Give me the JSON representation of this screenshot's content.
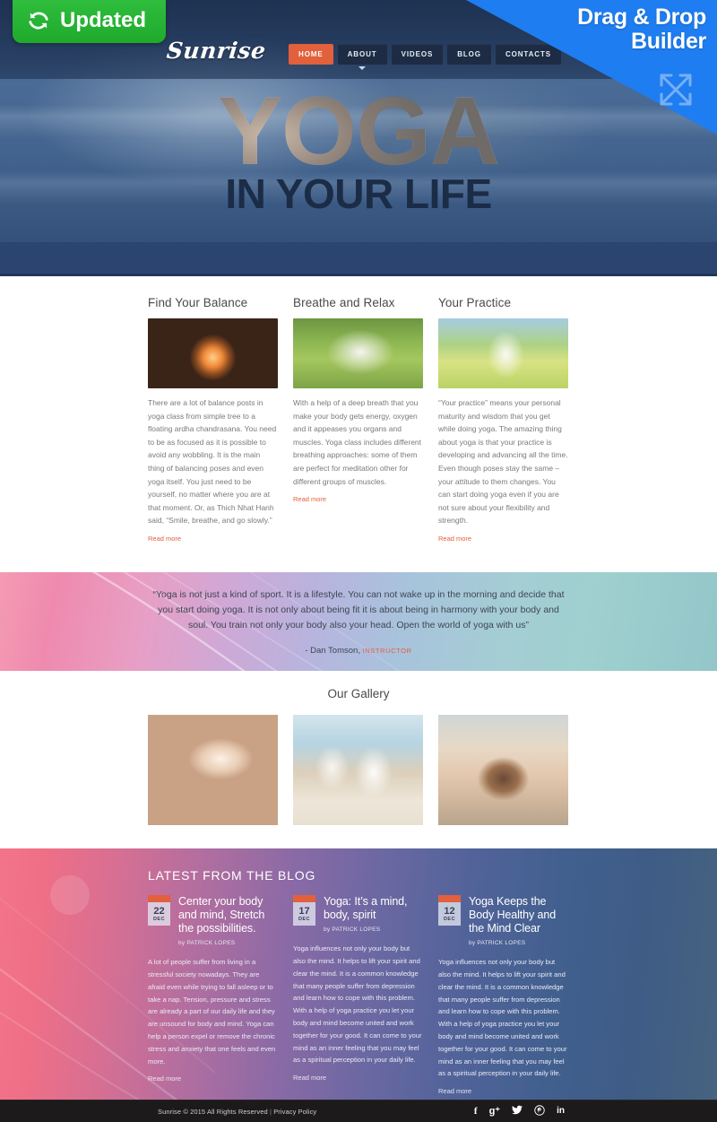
{
  "badge": {
    "label": "Updated",
    "icon": "sync-icon",
    "color": "#2bb93a"
  },
  "ribbon": {
    "line1": "Drag & Drop",
    "line2": "Builder",
    "icon": "drag-arrows-icon",
    "color": "#1e7df0"
  },
  "header": {
    "logo": "Sunrise",
    "nav": [
      {
        "label": "HOME",
        "active": true,
        "dropdown": false
      },
      {
        "label": "ABOUT",
        "active": false,
        "dropdown": true
      },
      {
        "label": "VIDEOS",
        "active": false,
        "dropdown": false
      },
      {
        "label": "BLOG",
        "active": false,
        "dropdown": false
      },
      {
        "label": "CONTACTS",
        "active": false,
        "dropdown": false
      }
    ]
  },
  "hero": {
    "headline": "YOGA",
    "subhead": "IN YOUR LIFE"
  },
  "features": [
    {
      "title": "Find Your Balance",
      "image": "yoga-silhouette-sunset-photo",
      "text": "There are a lot of balance posts in yoga class from simple tree to a floating ardha chandrasana. You need to be as focused as it is possible to avoid any wobbling. It is the main thing of balancing poses and even yoga itself. You just need to be yourself, no matter where you are at that moment. Or, as Thich Nhat Hanh said, “Smile, breathe, and go slowly.”",
      "link": "Read more"
    },
    {
      "title": "Breathe and Relax",
      "image": "cobra-pose-grass-photo",
      "text": "With a help of a deep breath that you make your body gets energy, oxygen and it appeases you organs and muscles. Yoga class includes different breathing approaches: some of them are perfect for meditation other for different groups of muscles.",
      "link": "Read more"
    },
    {
      "title": "Your Practice",
      "image": "meditation-field-photo",
      "text": "“Your practice” means your personal maturity and wisdom that you get while doing yoga. The amazing thing about yoga is that your practice is developing and advancing all the time. Even though poses stay the same – your attitude to them changes. You can start doing yoga even if you are not sure about your flexibility and strength.",
      "link": "Read more"
    }
  ],
  "quote": {
    "text": "“Yoga is not just a kind of sport. It is a lifestyle. You can not wake up in the morning and decide that you start doing yoga. It is not only about being fit it is about being in harmony with your body and soul. You train not only your body also your head. Open the world of yoga with us”",
    "author": "- Dan Tomson,",
    "role": "INSTRUCTOR",
    "role_color": "#e2603c"
  },
  "gallery": {
    "title": "Our Gallery",
    "images": [
      "mudra-hand-closeup-photo",
      "two-women-beach-meditation-photo",
      "back-stretch-flower-hair-photo"
    ]
  },
  "blog": {
    "title": "LATEST FROM THE BLOG",
    "posts": [
      {
        "day": "22",
        "month": "DEC",
        "title": "Center your body and mind, Stretch the possibilities.",
        "by": "by PATRICK LOPES",
        "text": "A lot of people suffer from living in a stressful society nowadays. They are afraid even while trying to fall asleep or to take a nap. Tension, pressure and stress are already a part of our daily life and they are unsound for body and mind. Yoga can help a person expel or remove the chronic stress and anxiety that one feels and even more.",
        "link": "Read more"
      },
      {
        "day": "17",
        "month": "DEC",
        "title": "Yoga: It’s a mind, body, spirit",
        "by": "by PATRICK LOPES",
        "text": "Yoga influences not only your body but also the mind. It helps to lift your spirit and clear the mind. It is a common knowledge that many people suffer from depression and learn how to cope with this problem. With a help of yoga practice you let your body and mind become united and work together for your good. It can come to your mind as an inner feeling that you may feel as a spiritual perception in your daily life.",
        "link": "Read more"
      },
      {
        "day": "12",
        "month": "DEC",
        "title": "Yoga Keeps the Body Healthy and the Mind Clear",
        "by": "by PATRICK LOPES",
        "text": "Yoga influences not only your body but also the mind. It helps to lift your spirit and clear the mind. It is a common knowledge that many people suffer from depression and learn how to cope with this problem. With a help of yoga practice you let your body and mind become united and work together for your good. It can come to your mind as an inner feeling that you may feel as a spiritual perception in your daily life.",
        "link": "Read more"
      }
    ]
  },
  "footer": {
    "copyright": "Sunrise © 2015 All Rights Reserved",
    "separator": "|",
    "privacy": "Privacy Policy",
    "socials": [
      {
        "name": "facebook-icon",
        "glyph": "f"
      },
      {
        "name": "google-plus-icon",
        "glyph": "g+"
      },
      {
        "name": "twitter-icon",
        "glyph": "ᴛ"
      },
      {
        "name": "pinterest-icon",
        "glyph": "ⓟ"
      },
      {
        "name": "linkedin-icon",
        "glyph": "in"
      }
    ]
  }
}
